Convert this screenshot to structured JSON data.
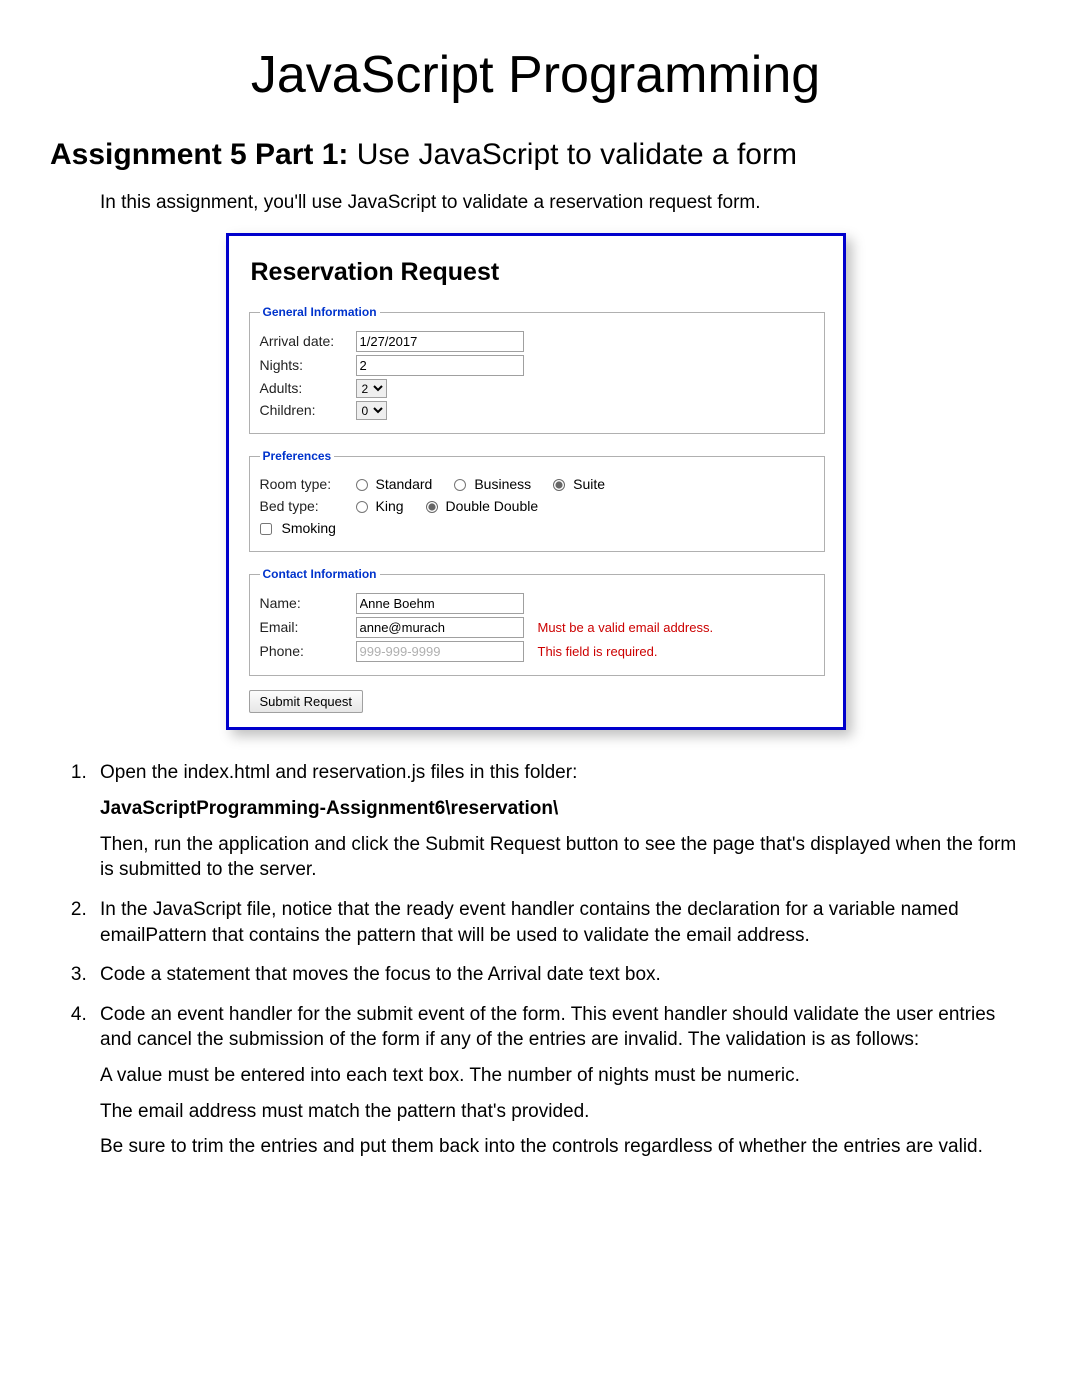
{
  "title": "JavaScript Programming",
  "subtitle_bold": "Assignment 5 Part 1:",
  "subtitle_rest": " Use JavaScript to validate a form",
  "intro": "In this assignment, you'll use JavaScript to validate a reservation request form.",
  "form": {
    "heading": "Reservation Request",
    "legend_general": "General Information",
    "legend_prefs": "Preferences",
    "legend_contact": "Contact Information",
    "arrival_label": "Arrival date:",
    "arrival_value": "1/27/2017",
    "nights_label": "Nights:",
    "nights_value": "2",
    "adults_label": "Adults:",
    "adults_value": "2",
    "children_label": "Children:",
    "children_value": "0",
    "roomtype_label": "Room type:",
    "room_standard": "Standard",
    "room_business": "Business",
    "room_suite": "Suite",
    "bedtype_label": "Bed type:",
    "bed_king": "King",
    "bed_double": "Double Double",
    "smoking_label": "Smoking",
    "name_label": "Name:",
    "name_value": "Anne Boehm",
    "email_label": "Email:",
    "email_value": "anne@murach",
    "email_error": "Must be a valid email address.",
    "phone_label": "Phone:",
    "phone_placeholder": "999-999-9999",
    "phone_error": "This field is required.",
    "submit_label": "Submit Request"
  },
  "steps": {
    "s1a": "Open the index.html and reservation.js files in this folder:",
    "s1b": "JavaScriptProgramming-Assignment6\\reservation\\",
    "s1c": "Then, run the application and click the Submit Request button to see the page that's displayed when the form is submitted to the server.",
    "s2": "In the JavaScript file, notice that the ready event handler contains the declaration for a variable named emailPattern that contains the pattern that will be used to validate the email address.",
    "s3": "Code a statement that moves the focus to the Arrival date text box.",
    "s4a": "Code an event handler for the submit event of the form. This event handler should validate the user entries and cancel the submission of the form if any of the entries are invalid. The validation is as follows:",
    "s4b": "A value must be entered into each text box. The number of nights must be numeric.",
    "s4c": "The email address must match the pattern that's provided.",
    "s4d": "Be sure to trim the entries and put them back into the controls regardless of whether the entries are valid."
  }
}
